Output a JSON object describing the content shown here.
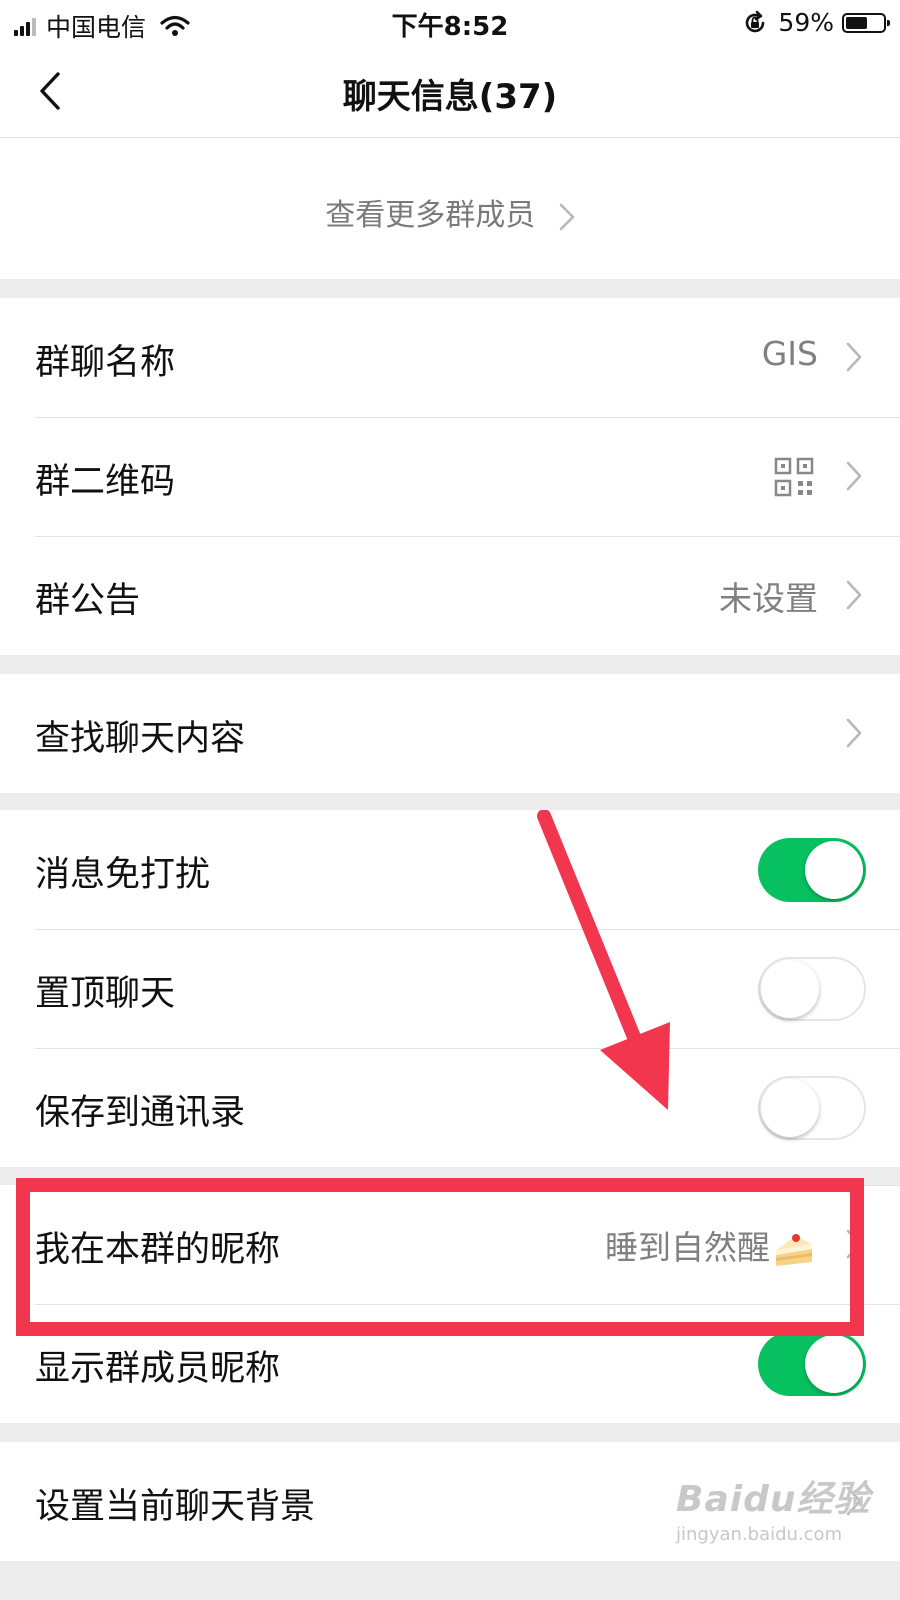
{
  "status_bar": {
    "carrier": "中国电信",
    "time": "下午8:52",
    "battery": "59%",
    "battery_level": 0.59
  },
  "nav": {
    "title": "聊天信息(37)"
  },
  "members": {
    "more_label": "查看更多群成员"
  },
  "section_group_info": {
    "rows": [
      {
        "label": "群聊名称",
        "value": "GIS"
      },
      {
        "label": "群二维码"
      },
      {
        "label": "群公告",
        "value": "未设置"
      }
    ]
  },
  "section_search": {
    "rows": [
      {
        "label": "查找聊天内容"
      }
    ]
  },
  "section_settings": {
    "rows": [
      {
        "label": "消息免打扰",
        "toggle": true
      },
      {
        "label": "置顶聊天",
        "toggle": false
      },
      {
        "label": "保存到通讯录",
        "toggle": false
      },
      {
        "label": "我在本群的昵称",
        "value": "睡到自然醒",
        "value_icon": "cake-icon"
      },
      {
        "label": "显示群成员昵称",
        "toggle": true
      }
    ]
  },
  "section_background": {
    "rows": [
      {
        "label": "设置当前聊天背景"
      }
    ]
  },
  "watermark": {
    "brand": "Baidu经验",
    "url": "jingyan.baidu.com"
  },
  "colors": {
    "toggle_on": "#07c160",
    "annotation": "#f2364d",
    "background": "#ededed"
  }
}
